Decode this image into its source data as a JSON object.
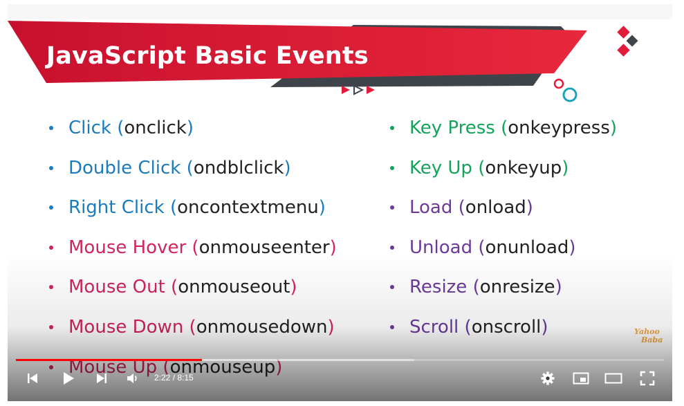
{
  "slide": {
    "title": "JavaScript Basic Events",
    "left_events": [
      {
        "name": "Click",
        "handler": "onclick",
        "color": "#1a7bbf"
      },
      {
        "name": "Double Click",
        "handler": "ondblclick",
        "color": "#1a7bbf"
      },
      {
        "name": "Right Click",
        "handler": "oncontextmenu",
        "color": "#1a7bbf"
      },
      {
        "name": "Mouse Hover",
        "handler": "onmouseenter",
        "color": "#d1245a"
      },
      {
        "name": "Mouse Out",
        "handler": "onmouseout",
        "color": "#d1245a"
      },
      {
        "name": "Mouse Down",
        "handler": "onmousedown",
        "color": "#d1245a"
      },
      {
        "name": "Mouse Up",
        "handler": "onmouseup",
        "color": "#d1245a"
      }
    ],
    "right_events": [
      {
        "name": "Key Press",
        "handler": "onkeypress",
        "color": "#14a35a"
      },
      {
        "name": "Key Up",
        "handler": "onkeyup",
        "color": "#14a35a"
      },
      {
        "name": "Load",
        "handler": "onload",
        "color": "#6b3a9a"
      },
      {
        "name": "Unload",
        "handler": "onunload",
        "color": "#6b3a9a"
      },
      {
        "name": "Resize",
        "handler": "onresize",
        "color": "#6b3a9a"
      },
      {
        "name": "Scroll",
        "handler": "onscroll",
        "color": "#6b3a9a"
      }
    ],
    "logo": {
      "line1": "Yahoo",
      "line2": "Baba"
    }
  },
  "player": {
    "current_time": "2:22",
    "separator": " / ",
    "duration": "8:15",
    "progress_played": 0.287,
    "progress_loaded": 0.615,
    "accent_color": "#ff0000",
    "icons": [
      "previous-icon",
      "play-icon",
      "next-icon",
      "volume-icon",
      "settings-icon",
      "miniplayer-icon",
      "theater-icon",
      "fullscreen-icon"
    ]
  }
}
